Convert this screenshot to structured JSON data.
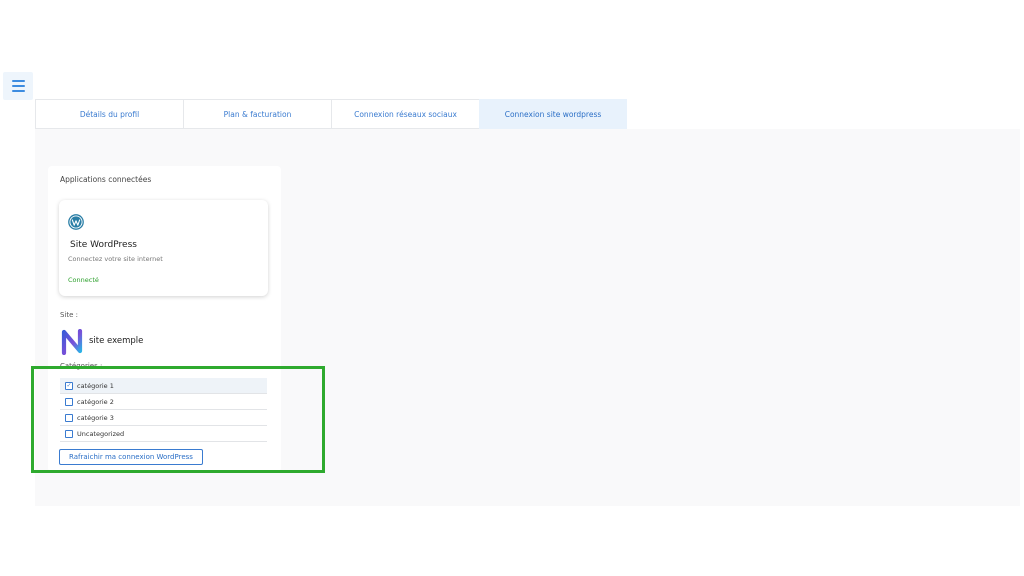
{
  "tabs": [
    {
      "label": "Détails du profil",
      "active": false
    },
    {
      "label": "Plan & facturation",
      "active": false
    },
    {
      "label": "Connexion réseaux sociaux",
      "active": false
    },
    {
      "label": "Connexion site wordpress",
      "active": true
    }
  ],
  "connected_apps": {
    "title": "Applications connectées",
    "app": {
      "icon": "wordpress-icon",
      "name": "Site WordPress",
      "description": "Connectez votre site internet",
      "status": "Connecté"
    }
  },
  "site": {
    "label": "Site :",
    "logo": "site-logo-n",
    "name": "site exemple"
  },
  "categories": {
    "label": "Catégories :",
    "items": [
      {
        "label": "catégorie 1",
        "checked": true
      },
      {
        "label": "catégorie 2",
        "checked": false
      },
      {
        "label": "catégorie 3",
        "checked": false
      },
      {
        "label": "Uncategorized",
        "checked": false
      }
    ]
  },
  "refresh_button_label": "Rafraichir ma connexion WordPress",
  "colors": {
    "accent": "#3a7bd0",
    "active_tab_bg": "#e8f2fc",
    "connected_status": "#2ca02c",
    "highlight": "#2eaa2e"
  }
}
